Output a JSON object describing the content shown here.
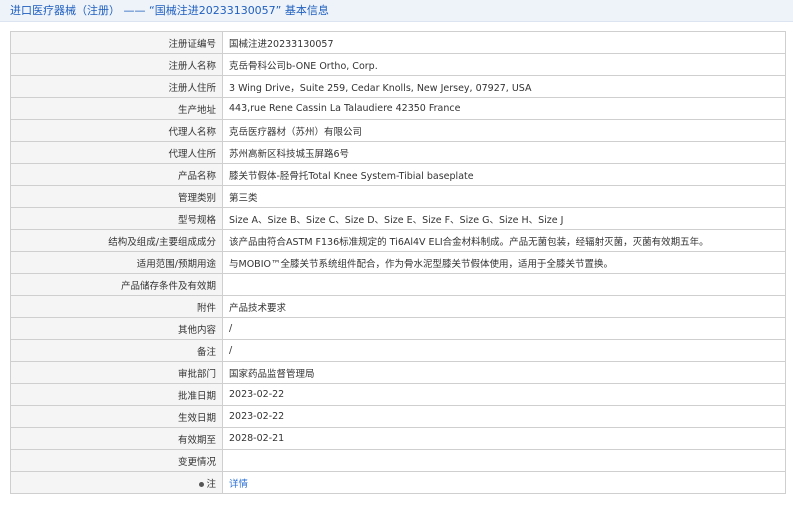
{
  "header": {
    "prefix": "进口医疗器械（注册）",
    "dash": "——",
    "title": "“国械注进20233130057”",
    "suffix": "基本信息"
  },
  "rows": [
    {
      "label": "注册证编号",
      "value": "国械注进20233130057"
    },
    {
      "label": "注册人名称",
      "value": "克岳骨科公司b-ONE Ortho, Corp."
    },
    {
      "label": "注册人住所",
      "value": "3 Wing Drive，Suite 259, Cedar Knolls, New Jersey, 07927, USA"
    },
    {
      "label": "生产地址",
      "value": "443,rue Rene Cassin La Talaudiere 42350 France"
    },
    {
      "label": "代理人名称",
      "value": "克岳医疗器材（苏州）有限公司"
    },
    {
      "label": "代理人住所",
      "value": "苏州高新区科技城玉屏路6号"
    },
    {
      "label": "产品名称",
      "value": "膝关节假体-胫骨托Total Knee System-Tibial baseplate"
    },
    {
      "label": "管理类别",
      "value": "第三类"
    },
    {
      "label": "型号规格",
      "value": "Size A、Size B、Size C、Size D、Size E、Size F、Size G、Size H、Size J"
    },
    {
      "label": "结构及组成/主要组成成分",
      "value": "该产品由符合ASTM F136标准规定的 Ti6Al4V ELI合金材料制成。产品无菌包装，经辐射灭菌，灭菌有效期五年。"
    },
    {
      "label": "适用范围/预期用途",
      "value": "与MOBIO™全膝关节系统组件配合，作为骨水泥型膝关节假体使用，适用于全膝关节置换。"
    },
    {
      "label": "产品储存条件及有效期",
      "value": ""
    },
    {
      "label": "附件",
      "value": "产品技术要求"
    },
    {
      "label": "其他内容",
      "value": "/"
    },
    {
      "label": "备注",
      "value": "/"
    },
    {
      "label": "审批部门",
      "value": "国家药品监督管理局"
    },
    {
      "label": "批准日期",
      "value": "2023-02-22"
    },
    {
      "label": "生效日期",
      "value": "2023-02-22"
    },
    {
      "label": "有效期至",
      "value": "2028-02-21"
    },
    {
      "label": "变更情况",
      "value": ""
    }
  ],
  "note_row": {
    "label": "注",
    "link": "详情"
  }
}
